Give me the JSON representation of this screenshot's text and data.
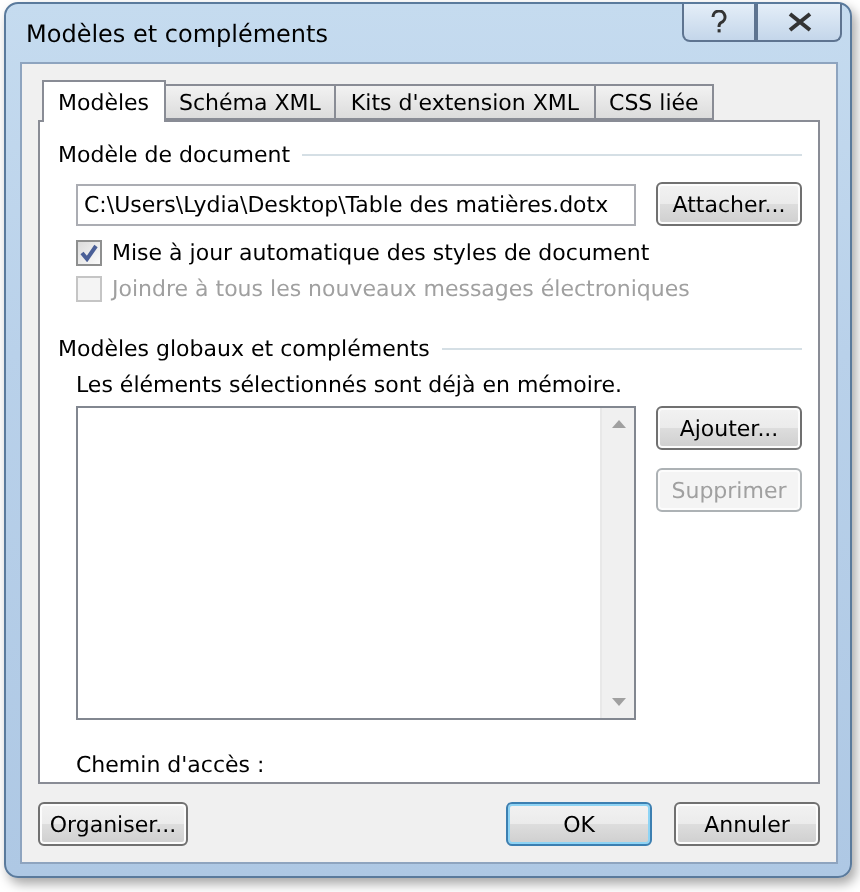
{
  "window": {
    "title": "Modèles et compléments"
  },
  "tabs": [
    {
      "label": "Modèles",
      "selected": true
    },
    {
      "label": "Schéma XML",
      "selected": false
    },
    {
      "label": "Kits d'extension XML",
      "selected": false
    },
    {
      "label": "CSS liée",
      "selected": false
    }
  ],
  "document_template": {
    "heading": "Modèle de document",
    "path": "C:\\Users\\Lydia\\Desktop\\Table des matières.dotx",
    "attach_button": {
      "label": "Attacher...",
      "disabled": false
    },
    "options": [
      {
        "label": "Mise à jour automatique des styles de document",
        "checked": true,
        "disabled": false
      },
      {
        "label": "Joindre à tous les nouveaux messages électroniques",
        "checked": false,
        "disabled": true
      }
    ]
  },
  "global_templates": {
    "heading": "Modèles globaux et compléments",
    "note": "Les éléments sélectionnés sont déjà en mémoire.",
    "buttons": [
      {
        "label": "Ajouter...",
        "disabled": false
      },
      {
        "label": "Supprimer",
        "disabled": true
      }
    ],
    "path_label": "Chemin d'accès :"
  },
  "footer_buttons": [
    {
      "label": "Organiser...",
      "default": false,
      "disabled": false
    },
    {
      "label": "OK",
      "default": true,
      "disabled": false
    },
    {
      "label": "Annuler",
      "default": false,
      "disabled": false
    }
  ]
}
